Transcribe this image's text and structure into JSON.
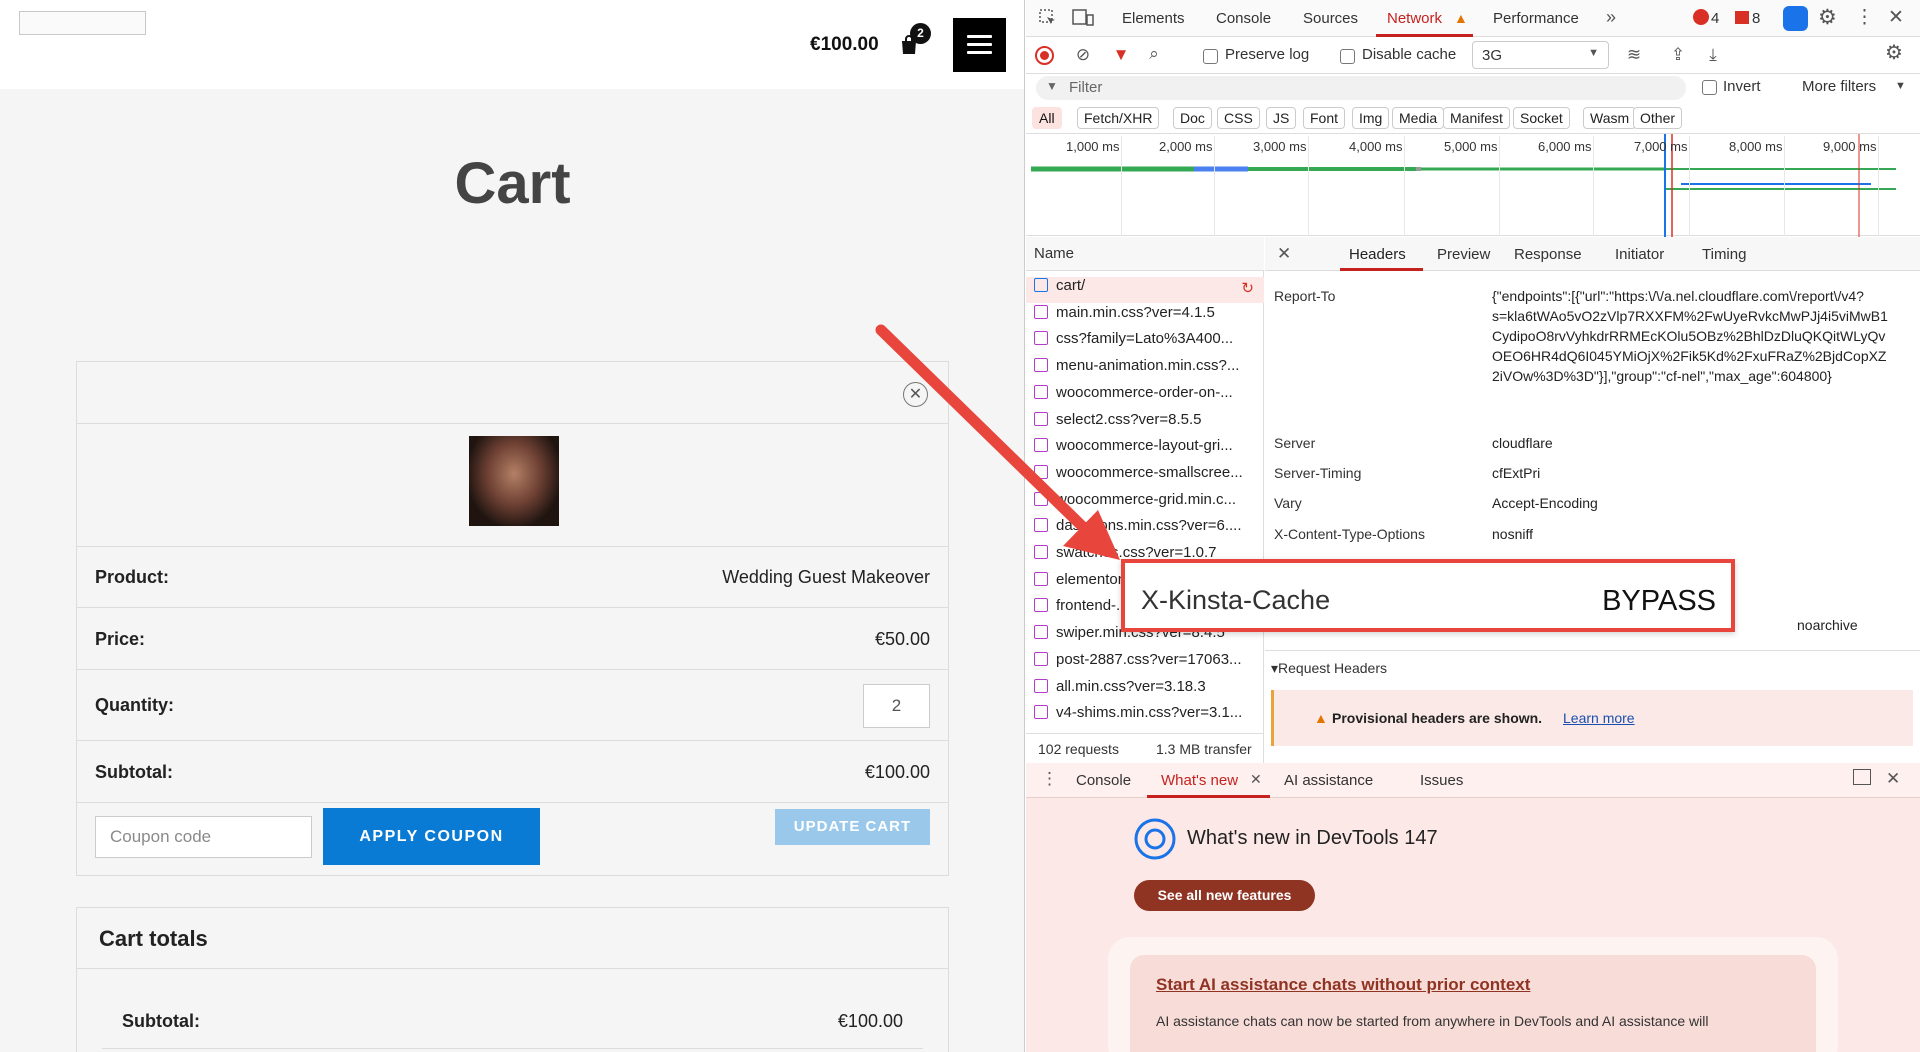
{
  "site": {
    "header": {
      "cart_total": "€100.00",
      "cart_count": "2"
    },
    "page_title": "Cart",
    "cart": {
      "product_label": "Product:",
      "product_value": "Wedding Guest Makeover",
      "price_label": "Price:",
      "price_value": "€50.00",
      "quantity_label": "Quantity:",
      "quantity_value": "2",
      "subtotal_label": "Subtotal:",
      "subtotal_value": "€100.00",
      "coupon_placeholder": "Coupon code",
      "apply_label": "APPLY COUPON",
      "update_label": "UPDATE CART"
    },
    "totals": {
      "title": "Cart totals",
      "subtotal_label": "Subtotal:",
      "subtotal_value": "€100.00"
    }
  },
  "devtools": {
    "tabs": [
      "Elements",
      "Console",
      "Sources",
      "Network",
      "Performance"
    ],
    "more_tabs": "»",
    "error_count": "4",
    "warning_count": "8",
    "toolbar": {
      "preserve_log": "Preserve log",
      "disable_cache": "Disable cache",
      "throttle": "3G"
    },
    "filter": {
      "placeholder": "Filter",
      "invert": "Invert",
      "more_filters": "More filters"
    },
    "type_filters": [
      "All",
      "Fetch/XHR",
      "Doc",
      "CSS",
      "JS",
      "Font",
      "Img",
      "Media",
      "Manifest",
      "Socket",
      "Wasm",
      "Other"
    ],
    "timeline_labels": [
      "1,000 ms",
      "2,000 ms",
      "3,000 ms",
      "4,000 ms",
      "5,000 ms",
      "6,000 ms",
      "7,000 ms",
      "8,000 ms",
      "9,000 ms"
    ],
    "name_header": "Name",
    "requests": [
      "cart/",
      "main.min.css?ver=4.1.5",
      "css?family=Lato%3A400...",
      "menu-animation.min.css?...",
      "woocommerce-order-on-...",
      "select2.css?ver=8.5.5",
      "woocommerce-layout-gri...",
      "woocommerce-smallscree...",
      "woocommerce-grid.min.c...",
      "dashicons.min.css?ver=6....",
      "swatches.css?ver=1.0.7",
      "elementor-...",
      "frontend-...",
      "swiper.min.css?ver=8.4.5",
      "post-2887.css?ver=17063...",
      "all.min.css?ver=3.18.3",
      "v4-shims.min.css?ver=3.1..."
    ],
    "status": {
      "requests": "102 requests",
      "transfer": "1.3 MB transfer"
    },
    "detail_tabs": [
      "Headers",
      "Preview",
      "Response",
      "Initiator",
      "Timing"
    ],
    "headers": [
      {
        "key": "Report-To",
        "value": "{\"endpoints\":[{\"url\":\"https:\\/\\/a.nel.cloudflare.com\\/report\\/v4?s=kla6tWAo5vO2zVlp7RXXFM%2FwUyeRvkcMwPJj4i5viMwB1CydipoO8rvVyhkdrRRMEcKOlu5OBz%2BhlDzDluQKQitWLyQvOEO6HR4dQ6I045YMiOjX%2Fik5Kd%2FxuFRaZ%2BjdCopXZ2iVOw%3D%3D\"}],\"group\":\"cf-nel\",\"max_age\":604800}"
      },
      {
        "key": "Server",
        "value": "cloudflare"
      },
      {
        "key": "Server-Timing",
        "value": "cfExtPri"
      },
      {
        "key": "Vary",
        "value": "Accept-Encoding"
      },
      {
        "key": "X-Content-Type-Options",
        "value": "nosniff"
      }
    ],
    "partial_value": "noarchive",
    "highlight": {
      "key": "X-Kinsta-Cache",
      "value": "BYPASS"
    },
    "request_headers": "▾Request Headers",
    "provisional": "Provisional headers are shown.",
    "learn_more": "Learn more",
    "drawer_tabs": [
      "Console",
      "What's new",
      "AI assistance",
      "Issues"
    ],
    "whats_new": {
      "title": "What's new in DevTools 147",
      "button": "See all new features",
      "card_title": "Start AI assistance chats without prior context",
      "card_text": "AI assistance chats can now be started from anywhere in DevTools and AI assistance will"
    },
    "colors": {
      "accent_red": "#c5221f",
      "focus_red": "#e8453c",
      "blue_button": "#0a7bd4"
    }
  }
}
